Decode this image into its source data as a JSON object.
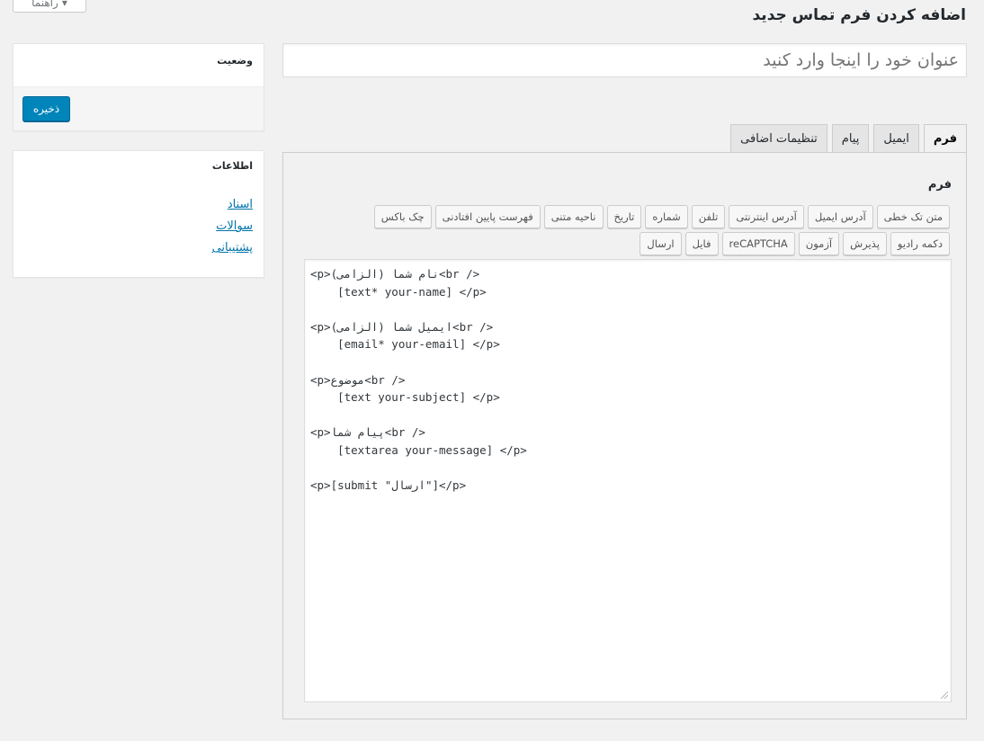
{
  "help": {
    "label": "راهنما",
    "arrow": "▾"
  },
  "page": {
    "title": "اضافه کردن فرم تماس جدید"
  },
  "title_input": {
    "placeholder": "عنوان خود را اینجا وارد کنید",
    "value": ""
  },
  "status_box": {
    "title": "وضعیت",
    "save_label": "ذخیره"
  },
  "info_box": {
    "title": "اطلاعات",
    "links": [
      "اسناد",
      "سوالات",
      "پشتیبانی"
    ]
  },
  "tabs": [
    "فرم",
    "ایمیل",
    "پیام",
    "تنظیمات اضافی"
  ],
  "form_panel": {
    "title": "فرم",
    "tag_buttons_row1": [
      "متن تک خطی",
      "آدرس ایمیل",
      "آدرس اینترنتی",
      "تلفن",
      "شماره",
      "تاریخ",
      "ناحیه متنی",
      "فهرست پایین افتادنی",
      "چک باکس"
    ],
    "tag_buttons_row2": [
      "دکمه رادیو",
      "پذیرش",
      "آزمون",
      "reCAPTCHA",
      "فایل",
      "ارسال"
    ],
    "code_lines": [
      "<p>نام شما (الزامی)<br />",
      "    [text* your-name] </p>",
      "",
      "<p>ایمیل شما (الزامی)<br />",
      "    [email* your-email] </p>",
      "",
      "<p>موضوع<br />",
      "    [text your-subject] </p>",
      "",
      "<p>پیام شما<br />",
      "    [textarea your-message] </p>",
      "",
      "<p>[submit \"ارسال\"]</p>"
    ]
  }
}
